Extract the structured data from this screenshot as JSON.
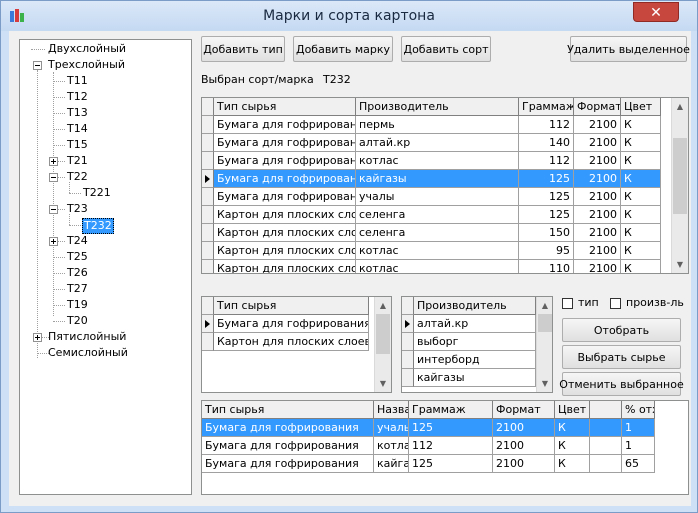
{
  "window": {
    "title": "Марки и сорта картона",
    "close": "✕"
  },
  "tree": {
    "dvuh": "Двухслойный",
    "treh": "Трехслойный",
    "t11": "Т11",
    "t12": "Т12",
    "t13": "Т13",
    "t14": "Т14",
    "t15": "Т15",
    "t21": "Т21",
    "t22": "Т22",
    "t221": "Т221",
    "t23": "Т23",
    "t232": "Т232",
    "t24": "Т24",
    "t25": "Т25",
    "t26": "Т26",
    "t27": "Т27",
    "t19": "Т19",
    "t20": "Т20",
    "pyat": "Пятислойный",
    "sem": "Семислойный"
  },
  "toolbar": {
    "add_type": "Добавить тип",
    "add_brand": "Добавить марку",
    "add_grade": "Добавить сорт",
    "delete_selected": "Удалить выделенное"
  },
  "selection": {
    "label": "Выбран сорт/марка",
    "value": "Т232"
  },
  "main_grid": {
    "headers": {
      "type": "Тип сырья",
      "producer": "Производитель",
      "weight": "Граммаж",
      "format": "Формат",
      "color": "Цвет"
    },
    "rows": [
      {
        "type": "Бумага для гофрирования",
        "producer": "пермь",
        "weight": "112",
        "format": "2100",
        "color": "К"
      },
      {
        "type": "Бумага для гофрирования",
        "producer": "алтай.кр",
        "weight": "140",
        "format": "2100",
        "color": "К"
      },
      {
        "type": "Бумага для гофрирования",
        "producer": "котлас",
        "weight": "112",
        "format": "2100",
        "color": "К"
      },
      {
        "type": "Бумага для гофрирования",
        "producer": "кайгазы",
        "weight": "125",
        "format": "2100",
        "color": "К"
      },
      {
        "type": "Бумага для гофрирования",
        "producer": "учалы",
        "weight": "125",
        "format": "2100",
        "color": "К"
      },
      {
        "type": "Картон для плоских слоев",
        "producer": "селенга",
        "weight": "125",
        "format": "2100",
        "color": "К"
      },
      {
        "type": "Картон для плоских слоев",
        "producer": "селенга",
        "weight": "150",
        "format": "2100",
        "color": "К"
      },
      {
        "type": "Картон для плоских слоев",
        "producer": "котлас",
        "weight": "95",
        "format": "2100",
        "color": "К"
      },
      {
        "type": "Картон для плоских слоев",
        "producer": "котлас",
        "weight": "110",
        "format": "2100",
        "color": "К"
      }
    ]
  },
  "type_grid": {
    "header": "Тип сырья",
    "rows": [
      "Бумага для гофрирования",
      "Картон для плоских слоев"
    ]
  },
  "producer_grid": {
    "header": "Производитель",
    "rows": [
      "алтай.кр",
      "выборг",
      "интерборд",
      "кайгазы"
    ]
  },
  "filters": {
    "type": "тип",
    "producer": "произв-ль"
  },
  "actions": {
    "select": "Отобрать",
    "choose_raw": "Выбрать сырье",
    "cancel_selected": "Отменить выбранное"
  },
  "bottom_grid": {
    "headers": {
      "type": "Тип сырья",
      "name": "Назва",
      "weight": "Граммаж",
      "format": "Формат",
      "color": "Цвет",
      "blank": "",
      "percent": "% отх"
    },
    "rows": [
      {
        "type": "Бумага для гофрирования",
        "name": "учалы",
        "weight": "125",
        "format": "2100",
        "color": "К",
        "blank": "",
        "percent": "1"
      },
      {
        "type": "Бумага для гофрирования",
        "name": "котлас",
        "weight": "112",
        "format": "2100",
        "color": "К",
        "blank": "",
        "percent": "1"
      },
      {
        "type": "Бумага для гофрирования",
        "name": "кайгазы",
        "weight": "125",
        "format": "2100",
        "color": "К",
        "blank": "",
        "percent": "65"
      }
    ]
  }
}
